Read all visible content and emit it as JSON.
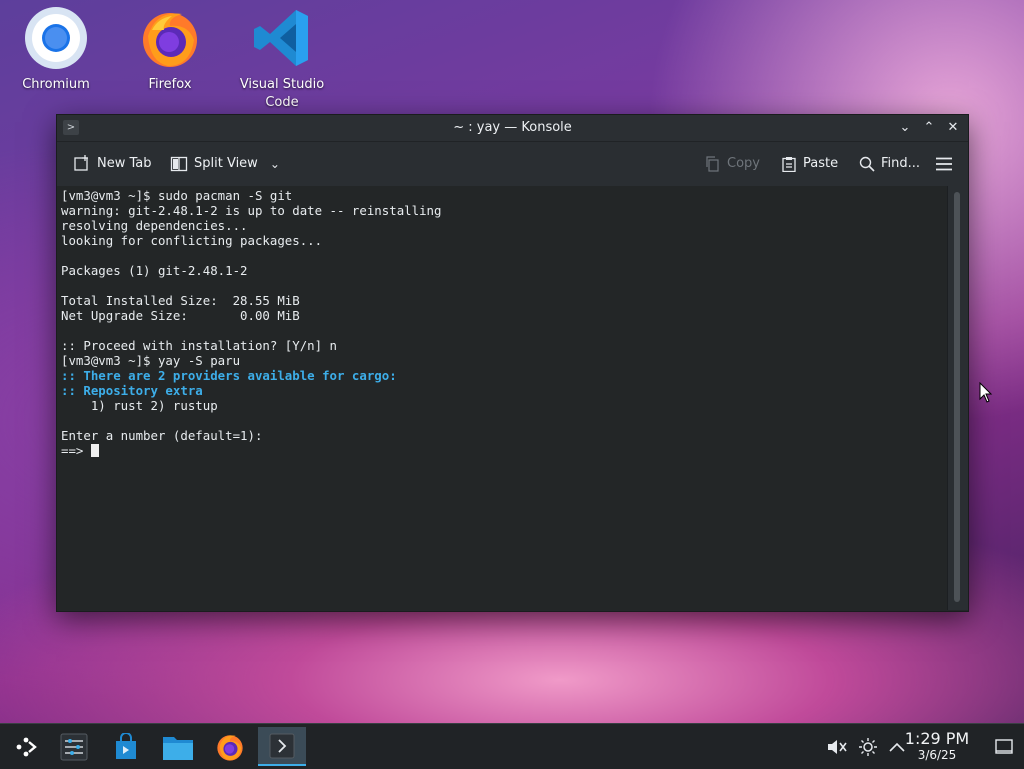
{
  "desktop": {
    "icons": [
      {
        "label": "Chromium",
        "icon": "chromium-icon"
      },
      {
        "label": "Firefox",
        "icon": "firefox-icon"
      },
      {
        "label": "Visual Studio Code",
        "icon": "vscode-icon"
      }
    ]
  },
  "window": {
    "title": "~ : yay — Konsole",
    "toolbar": {
      "new_tab": "New Tab",
      "split_view": "Split View",
      "copy": "Copy",
      "paste": "Paste",
      "find": "Find..."
    }
  },
  "terminal": {
    "lines": [
      {
        "text": "[vm3@vm3 ~]$ sudo pacman -S git",
        "style": "normal"
      },
      {
        "text": "warning: git-2.48.1-2 is up to date -- reinstalling",
        "style": "normal"
      },
      {
        "text": "resolving dependencies...",
        "style": "normal"
      },
      {
        "text": "looking for conflicting packages...",
        "style": "normal"
      },
      {
        "text": "",
        "style": "normal"
      },
      {
        "text": "Packages (1) git-2.48.1-2",
        "style": "normal"
      },
      {
        "text": "",
        "style": "normal"
      },
      {
        "text": "Total Installed Size:  28.55 MiB",
        "style": "normal"
      },
      {
        "text": "Net Upgrade Size:       0.00 MiB",
        "style": "normal"
      },
      {
        "text": "",
        "style": "normal"
      },
      {
        "text": ":: Proceed with installation? [Y/n] n",
        "style": "normal"
      },
      {
        "text": "[vm3@vm3 ~]$ yay -S paru",
        "style": "normal"
      },
      {
        "text": ":: There are 2 providers available for cargo:",
        "style": "blue"
      },
      {
        "text": ":: Repository extra",
        "style": "blue"
      },
      {
        "text": "    1) rust 2) rustup",
        "style": "normal"
      },
      {
        "text": "",
        "style": "normal"
      },
      {
        "text": "Enter a number (default=1):",
        "style": "normal"
      },
      {
        "text": "==> ",
        "style": "prompt"
      }
    ]
  },
  "taskbar": {
    "items": [
      "application-launcher-icon",
      "system-settings-icon",
      "discover-store-icon",
      "file-manager-icon",
      "firefox-icon",
      "konsole-icon"
    ],
    "clock": {
      "time": "1:29 PM",
      "date": "3/6/25"
    }
  },
  "colors": {
    "accent": "#3daee9",
    "terminal_bg": "#232627",
    "terminal_fg": "#e8ecef"
  }
}
